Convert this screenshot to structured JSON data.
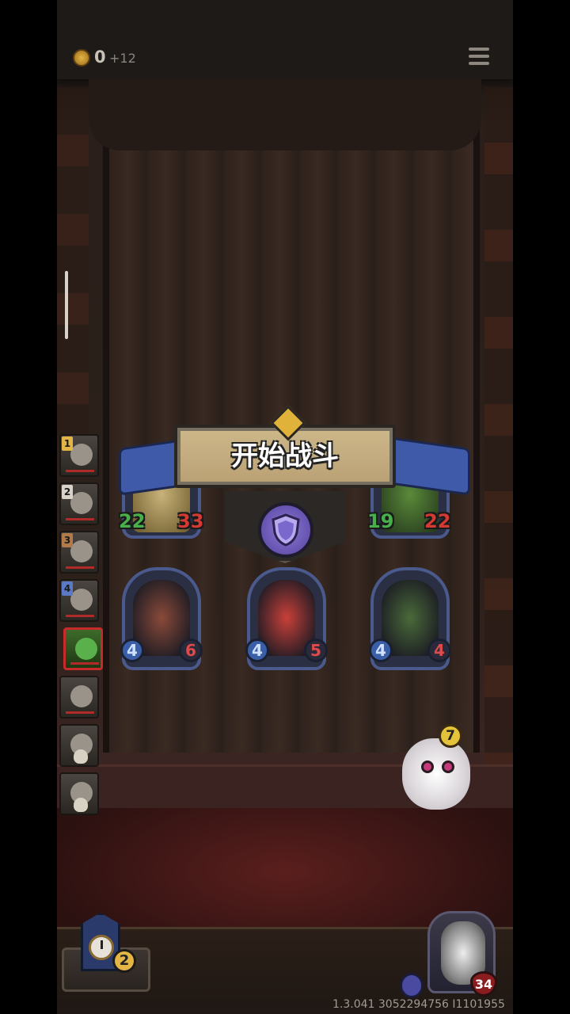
{
  "header": {
    "coins": "0",
    "coins_income": "+12"
  },
  "battle_banner": {
    "title": "开始战斗"
  },
  "turn_queue": [
    {
      "number": "1",
      "badge_color": "#e2b545",
      "portrait": "old-man-portrait"
    },
    {
      "number": "2",
      "badge_color": "#d8d2c8",
      "portrait": "rabbit-portrait"
    },
    {
      "number": "3",
      "badge_color": "#b07a4a",
      "portrait": "beast-portrait"
    },
    {
      "number": "4",
      "badge_color": "#5a7ac8",
      "portrait": "cat-portrait"
    },
    {
      "number": "",
      "badge_color": "",
      "portrait": "goblin-portrait",
      "active": true
    },
    {
      "number": "",
      "badge_color": "",
      "portrait": "cat-mask-portrait"
    },
    {
      "number": "",
      "badge_color": "",
      "portrait": "skull-grey-portrait"
    },
    {
      "number": "",
      "badge_color": "",
      "portrait": "skull-hood-portrait"
    }
  ],
  "enemy_row": [
    {
      "name": "round-face-enemy",
      "attack": "22",
      "health": "33"
    },
    {
      "name": "bird-enemy",
      "attack": "19",
      "health": "22"
    }
  ],
  "player_units": [
    {
      "name": "rogue-card",
      "attack": "4",
      "health": "6",
      "art_color": "#8a4a3a"
    },
    {
      "name": "tomato-card",
      "attack": "4",
      "health": "5",
      "art_color": "#c8403a"
    },
    {
      "name": "treant-card",
      "attack": "4",
      "health": "4",
      "art_color": "#4a6a3a"
    }
  ],
  "sheep": {
    "level": "7"
  },
  "timer": {
    "value": "2"
  },
  "hero": {
    "health": "34"
  },
  "version": "1.3.041 3052294756 I1101955",
  "colors": {
    "accent_blue": "#3f5aa8",
    "gold": "#e2b545",
    "health_red": "#d23a33",
    "attack_green": "#48b04a"
  }
}
